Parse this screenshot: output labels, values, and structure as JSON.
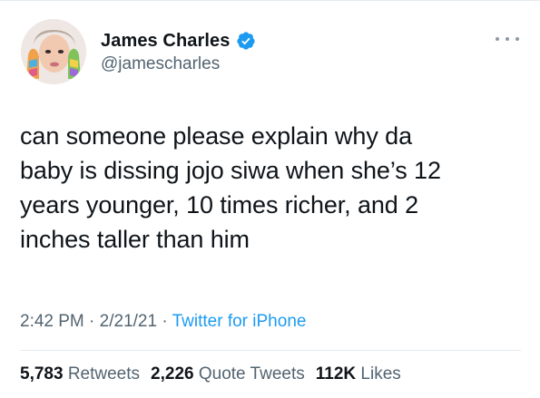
{
  "author": {
    "display_name": "James Charles",
    "handle": "@jamescharles",
    "verified": true
  },
  "tweet": {
    "text": "can someone please explain why da\nbaby is dissing jojo siwa when she’s 12\nyears younger, 10 times richer, and 2\ninches taller than him",
    "time": "2:42 PM",
    "date": "2/21/21",
    "separator": "·",
    "source": "Twitter for iPhone"
  },
  "stats": {
    "retweets_count": "5,783",
    "retweets_label": "Retweets",
    "quote_tweets_count": "2,226",
    "quote_tweets_label": "Quote Tweets",
    "likes_count": "112K",
    "likes_label": "Likes"
  },
  "icons": {
    "verified": "verified-badge-icon",
    "more": "more-options-icon"
  },
  "colors": {
    "text_primary": "#0f1419",
    "text_secondary": "#536471",
    "link": "#1d9bf0",
    "verified": "#1d9bf0",
    "divider": "#e6ecf0"
  }
}
